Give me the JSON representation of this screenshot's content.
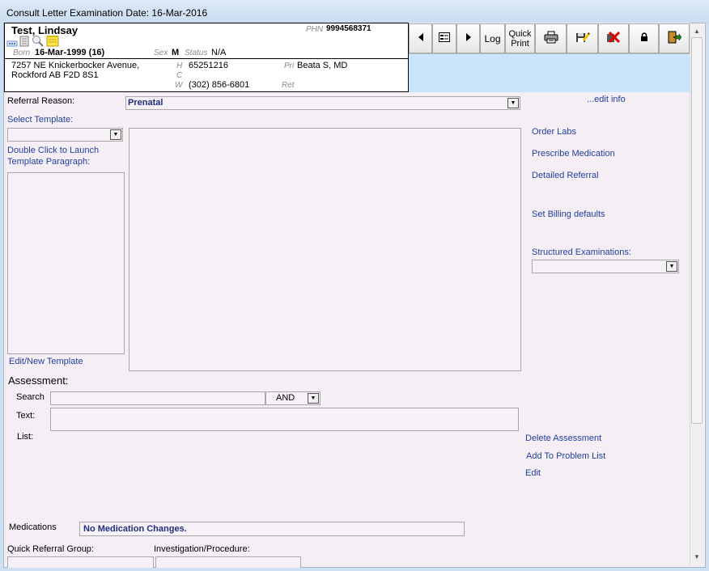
{
  "window": {
    "title": "Consult Letter Examination Date: 16-Mar-2016"
  },
  "patient": {
    "name": "Test, Lindsay",
    "phn_label": "PHN",
    "phn": "9994568371",
    "born_label": "Born",
    "born": "16-Mar-1999 (16)",
    "sex_label": "Sex",
    "sex": "M",
    "status_label": "Status",
    "status": "N/A",
    "address_line1": "7257 NE Knickerbocker Avenue,",
    "address_line2": "Rockford AB  F2D 8S1",
    "h_label": "H",
    "h_phone": "65251216",
    "c_label": "C",
    "w_label": "W",
    "w_phone": "(302) 856-6801",
    "pri_label": "Pri",
    "pri": "Beata S, MD",
    "ret_label": "Ret"
  },
  "toolbar": {
    "log_label": "Log",
    "quick_print_line1": "Quick",
    "quick_print_line2": "Print"
  },
  "form": {
    "referral_reason_label": "Referral Reason:",
    "referral_reason_value": "Prenatal",
    "edit_info": "...edit info",
    "select_template": "Select Template:",
    "double_click_line1": "Double Click to Launch",
    "double_click_line2": "Template Paragraph:",
    "edit_new_template": "Edit/New Template",
    "assessment_label": "Assessment:",
    "search_label": "Search",
    "and_label": "AND",
    "text_label": "Text:",
    "list_label": "List:",
    "medications_label": "Medications",
    "medications_value": "No Medication Changes.",
    "quick_referral_group": "Quick Referral Group:",
    "investigation_procedure": "Investigation/Procedure:"
  },
  "side_links": {
    "order_labs": "Order Labs",
    "prescribe_medication": "Prescribe Medication",
    "detailed_referral": "Detailed  Referral",
    "set_billing_defaults": "Set Billing defaults",
    "structured_examinations": "Structured Examinations:",
    "delete_assessment": "Delete Assessment",
    "add_to_problem_list": "Add To Problem List",
    "edit": "Edit"
  },
  "colors": {
    "link": "#1f3f9e",
    "form_background": "#f5eff5",
    "header_blue": "#c9e4fb"
  }
}
